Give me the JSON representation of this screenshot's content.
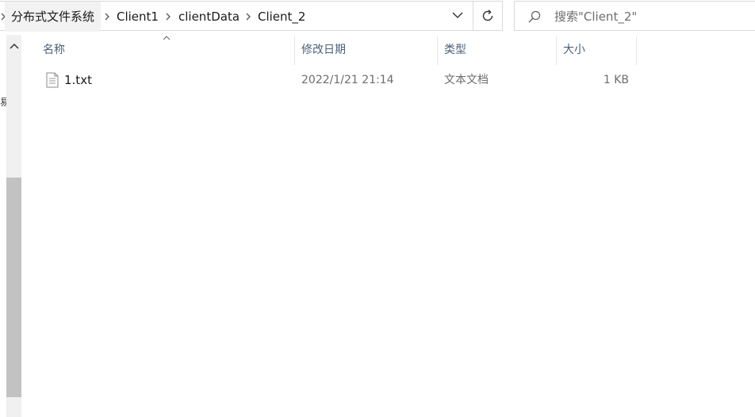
{
  "breadcrumb": {
    "items": [
      "分布式文件系统",
      "Client1",
      "clientData",
      "Client_2"
    ]
  },
  "search": {
    "placeholder": "搜索\"Client_2\""
  },
  "columns": {
    "name": "名称",
    "modified": "修改日期",
    "type": "类型",
    "size": "大小"
  },
  "files": [
    {
      "name": "1.txt",
      "modified": "2022/1/21 21:14",
      "type": "文本文档",
      "size": "1 KB"
    }
  ],
  "icons": {
    "dropdown": "chevron-down-icon",
    "refresh": "refresh-icon",
    "search": "search-icon",
    "file": "text-file-icon"
  }
}
